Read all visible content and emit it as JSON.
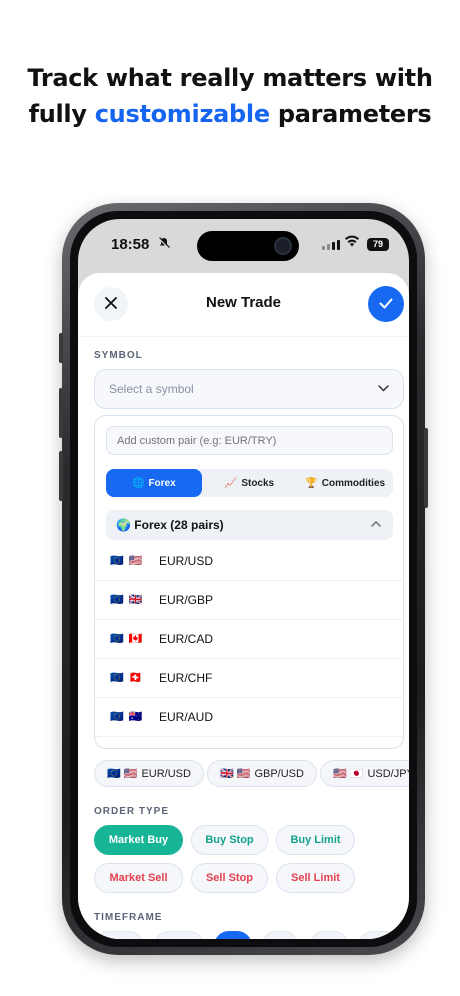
{
  "headline": {
    "line1": "Track what really matters with",
    "line2_accent": "customizable",
    "line2_prefix": "fully ",
    "line2_suffix": " parameters",
    "accent_color": "#1565f0"
  },
  "status_bar": {
    "time": "18:58",
    "battery": "79"
  },
  "sheet": {
    "title": "New Trade",
    "close_icon": "close-icon",
    "confirm_icon": "check-icon"
  },
  "symbol": {
    "label": "SYMBOL",
    "placeholder": "Select a symbol",
    "custom_placeholder": "Add custom pair (e.g: EUR/TRY)",
    "tabs": [
      {
        "icon": "🌐",
        "label": "Forex",
        "active": true
      },
      {
        "icon": "📈",
        "label": "Stocks",
        "active": false
      },
      {
        "icon": "🏆",
        "label": "Commodities",
        "active": false
      }
    ],
    "group": {
      "icon": "🌍",
      "label": "Forex (28 pairs)"
    },
    "pairs": [
      {
        "flags": "🇪🇺 🇺🇸",
        "name": "EUR/USD"
      },
      {
        "flags": "🇪🇺 🇬🇧",
        "name": "EUR/GBP"
      },
      {
        "flags": "🇪🇺 🇨🇦",
        "name": "EUR/CAD"
      },
      {
        "flags": "🇪🇺 🇨🇭",
        "name": "EUR/CHF"
      },
      {
        "flags": "🇪🇺 🇦🇺",
        "name": "EUR/AUD"
      }
    ],
    "quick_pairs": [
      {
        "flags": "🇪🇺 🇺🇸",
        "name": "EUR/USD"
      },
      {
        "flags": "🇬🇧 🇺🇸",
        "name": "GBP/USD"
      },
      {
        "flags": "🇺🇸 🇯🇵",
        "name": "USD/JPY"
      }
    ]
  },
  "order_type": {
    "label": "ORDER TYPE",
    "buy_options": [
      "Market Buy",
      "Buy Stop",
      "Buy Limit"
    ],
    "sell_options": [
      "Market Sell",
      "Sell Stop",
      "Sell Limit"
    ],
    "selected": "Market Buy",
    "buy_color": "#14a38a",
    "sell_color": "#e4404f"
  },
  "timeframe": {
    "label": "TIMEFRAME"
  },
  "colors": {
    "primary": "#1769f2",
    "success": "#17b596"
  }
}
